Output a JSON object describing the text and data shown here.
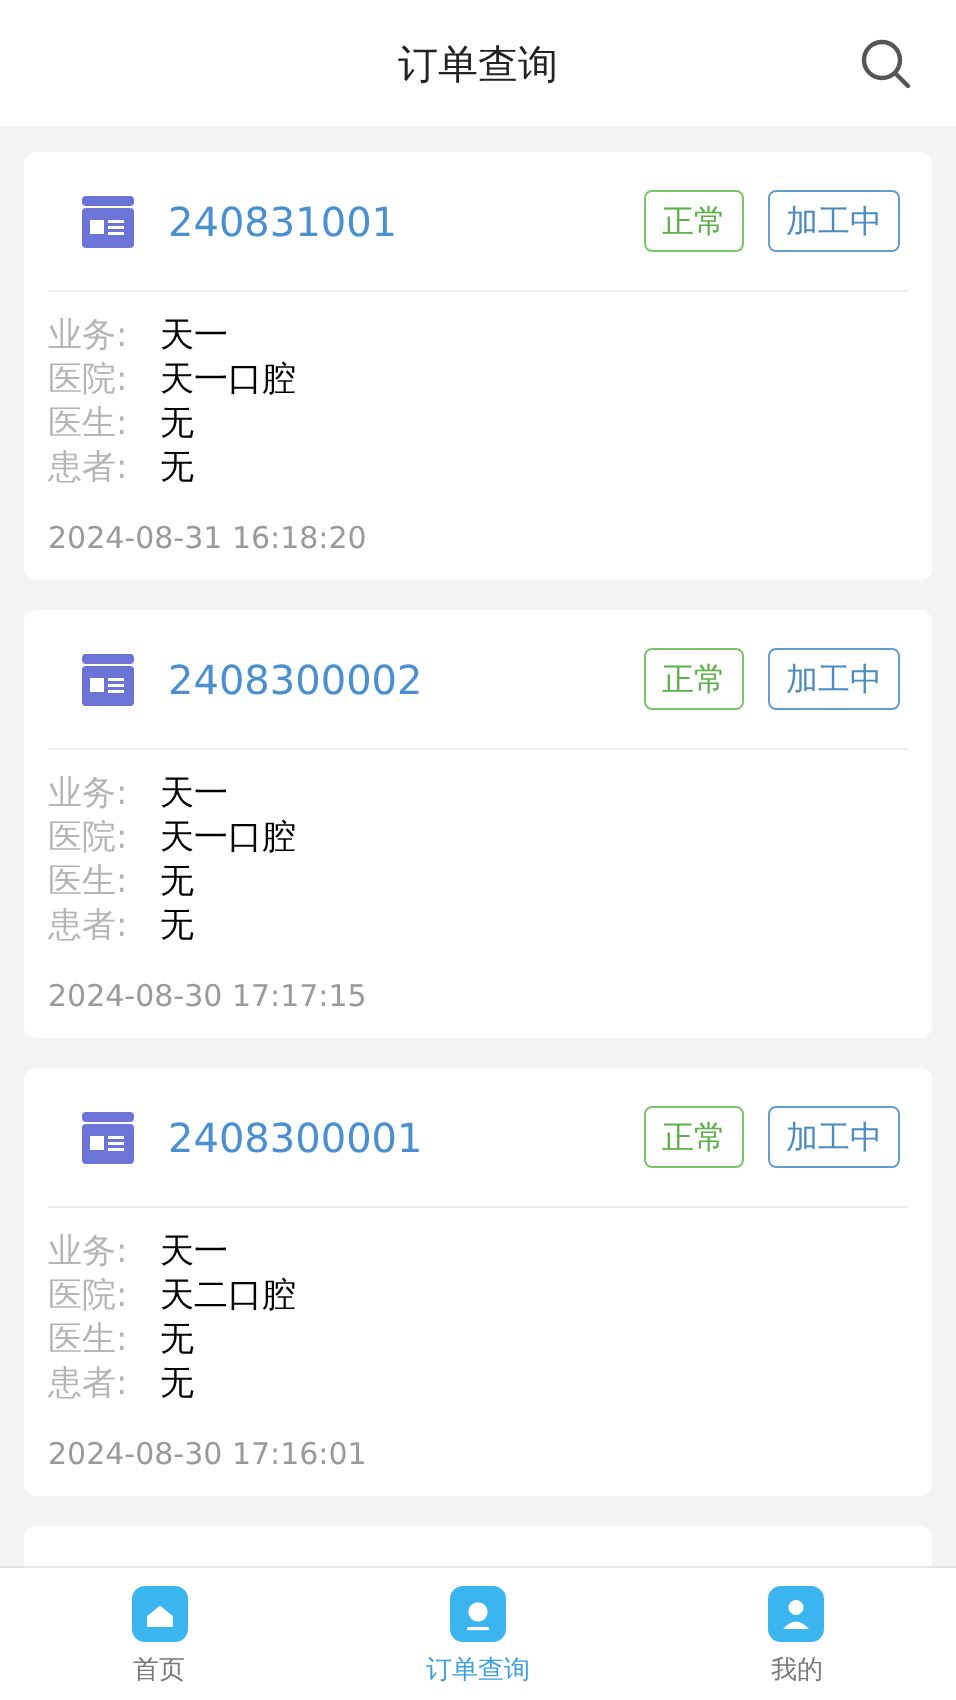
{
  "header": {
    "title": "订单查询"
  },
  "orders": [
    {
      "number": "240831001",
      "badges": [
        {
          "label": "正常",
          "kind": "status"
        },
        {
          "label": "加工中",
          "kind": "stage"
        }
      ],
      "fields": [
        {
          "label": "业务:",
          "value": "天一"
        },
        {
          "label": "医院:",
          "value": "天一口腔"
        },
        {
          "label": "医生:",
          "value": "无"
        },
        {
          "label": "患者:",
          "value": "无"
        }
      ],
      "time": "2024-08-31 16:18:20"
    },
    {
      "number": "2408300002",
      "badges": [
        {
          "label": "正常",
          "kind": "status"
        },
        {
          "label": "加工中",
          "kind": "stage"
        }
      ],
      "fields": [
        {
          "label": "业务:",
          "value": "天一"
        },
        {
          "label": "医院:",
          "value": "天一口腔"
        },
        {
          "label": "医生:",
          "value": "无"
        },
        {
          "label": "患者:",
          "value": "无"
        }
      ],
      "time": "2024-08-30 17:17:15"
    },
    {
      "number": "2408300001",
      "badges": [
        {
          "label": "正常",
          "kind": "status"
        },
        {
          "label": "加工中",
          "kind": "stage"
        }
      ],
      "fields": [
        {
          "label": "业务:",
          "value": "天一"
        },
        {
          "label": "医院:",
          "value": "天二口腔"
        },
        {
          "label": "医生:",
          "value": "无"
        },
        {
          "label": "患者:",
          "value": "无"
        }
      ],
      "time": "2024-08-30 17:16:01"
    }
  ],
  "tabs": [
    {
      "label": "首页",
      "kind": "home",
      "selected": false
    },
    {
      "label": "订单查询",
      "kind": "orders",
      "selected": true
    },
    {
      "label": "我的",
      "kind": "profile",
      "selected": false
    }
  ]
}
